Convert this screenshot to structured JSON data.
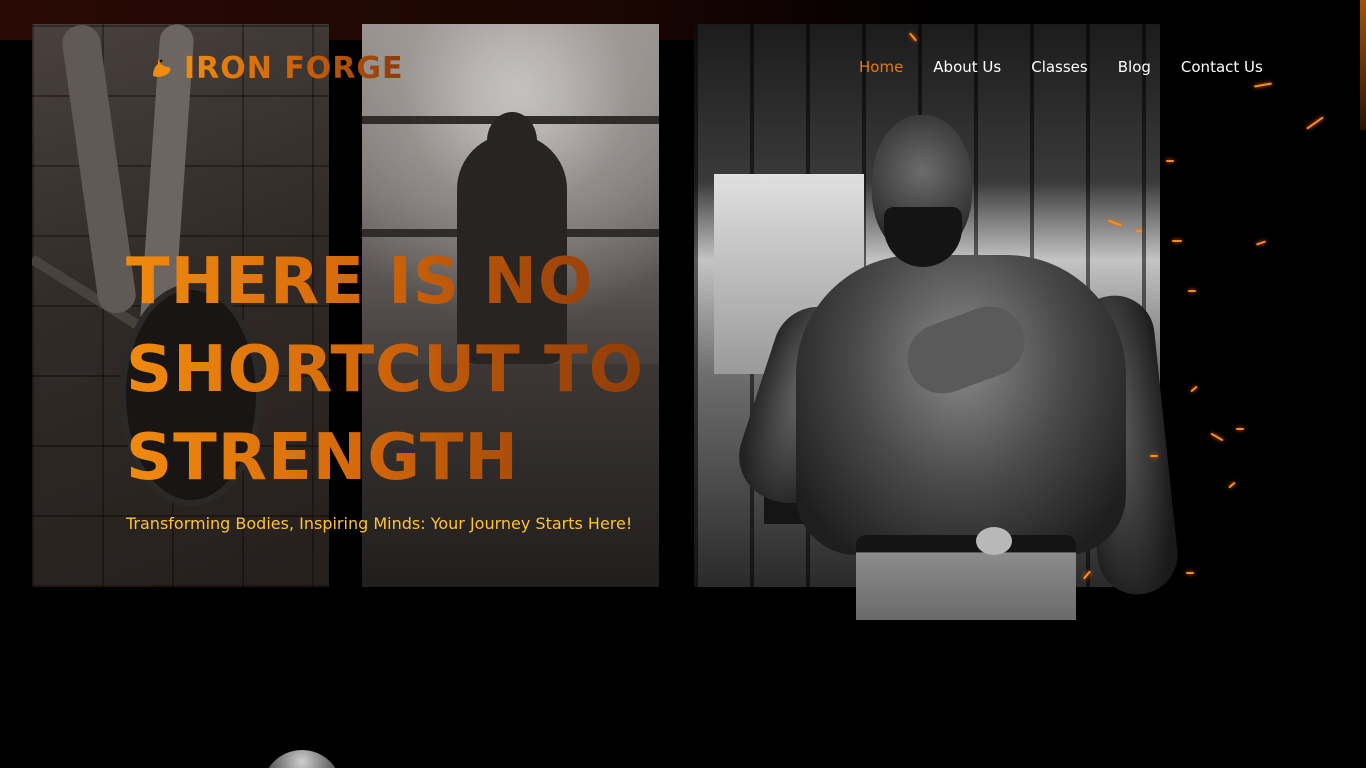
{
  "brand": {
    "name": "IRON FORGE",
    "logo_icon": "flexed-bicep-icon",
    "accent_color": "#e8820d"
  },
  "nav": {
    "items": [
      {
        "label": "Home",
        "active": true
      },
      {
        "label": "About Us",
        "active": false
      },
      {
        "label": "Classes",
        "active": false
      },
      {
        "label": "Blog",
        "active": false
      },
      {
        "label": "Contact Us",
        "active": false
      }
    ]
  },
  "hero": {
    "title_lines": [
      "THERE IS NO",
      "SHORTCUT TO",
      "STRENGTH"
    ],
    "subtitle": "Transforming Bodies, Inspiring Minds: Your Journey Starts Here!",
    "title_color_start": "#f08a0e",
    "title_color_end": "#7a3008",
    "subtitle_color": "#ffc233"
  }
}
